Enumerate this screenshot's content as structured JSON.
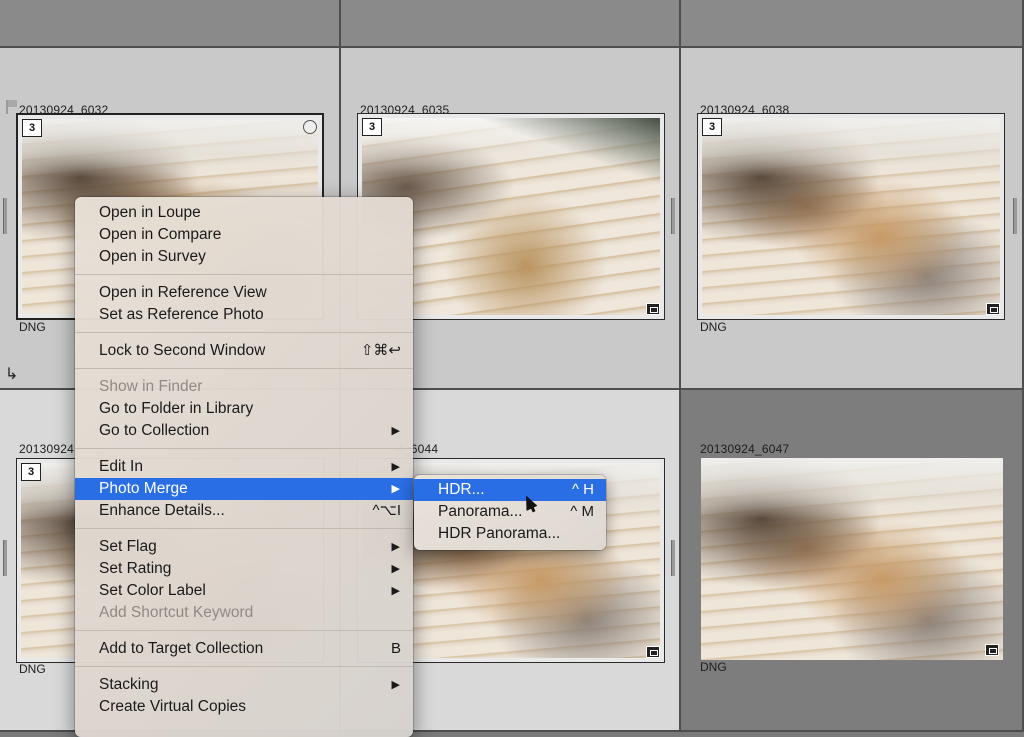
{
  "grid": {
    "cells": [
      {
        "id": "c1",
        "filename": "20130924_6032",
        "format": "DNG",
        "stack": "3",
        "selected": true
      },
      {
        "id": "c2",
        "filename": "20130924_6035",
        "format": "",
        "stack": "3"
      },
      {
        "id": "c3",
        "filename": "20130924_6038",
        "format": "DNG",
        "stack": "3"
      },
      {
        "id": "c4",
        "filename": "20130924",
        "format": "DNG",
        "stack": "3"
      },
      {
        "id": "c5",
        "filename": "4_6044",
        "format": "",
        "stack": ""
      },
      {
        "id": "c6",
        "filename": "20130924_6047",
        "format": "DNG",
        "stack": ""
      }
    ]
  },
  "menu": {
    "items": [
      {
        "label": "Open in Loupe"
      },
      {
        "label": "Open in Compare"
      },
      {
        "label": "Open in Survey"
      },
      {
        "sep": true
      },
      {
        "label": "Open in Reference View"
      },
      {
        "label": "Set as Reference Photo"
      },
      {
        "sep": true
      },
      {
        "label": "Lock to Second Window",
        "shortcut": "⇧⌘↩"
      },
      {
        "sep": true
      },
      {
        "label": "Show in Finder",
        "disabled": true
      },
      {
        "label": "Go to Folder in Library"
      },
      {
        "label": "Go to Collection",
        "submenu": true
      },
      {
        "sep": true
      },
      {
        "label": "Edit In",
        "submenu": true
      },
      {
        "label": "Photo Merge",
        "submenu": true,
        "active": true
      },
      {
        "label": "Enhance Details...",
        "shortcut": "^⌥I"
      },
      {
        "sep": true
      },
      {
        "label": "Set Flag",
        "submenu": true
      },
      {
        "label": "Set Rating",
        "submenu": true
      },
      {
        "label": "Set Color Label",
        "submenu": true
      },
      {
        "label": "Add Shortcut Keyword",
        "disabled": true
      },
      {
        "sep": true
      },
      {
        "label": "Add to Target Collection",
        "shortcut": "B"
      },
      {
        "sep": true
      },
      {
        "label": "Stacking",
        "submenu": true
      },
      {
        "label": "Create Virtual Copies"
      }
    ]
  },
  "submenu": {
    "items": [
      {
        "label": "HDR...",
        "shortcut": "^ H",
        "active": true
      },
      {
        "label": "Panorama...",
        "shortcut": "^ M"
      },
      {
        "label": "HDR Panorama..."
      }
    ]
  },
  "icons": {
    "submenu_arrow": "▶",
    "flag": "flag-icon",
    "stack_return": "↳"
  },
  "colors": {
    "highlight": "#2a6ee6"
  }
}
